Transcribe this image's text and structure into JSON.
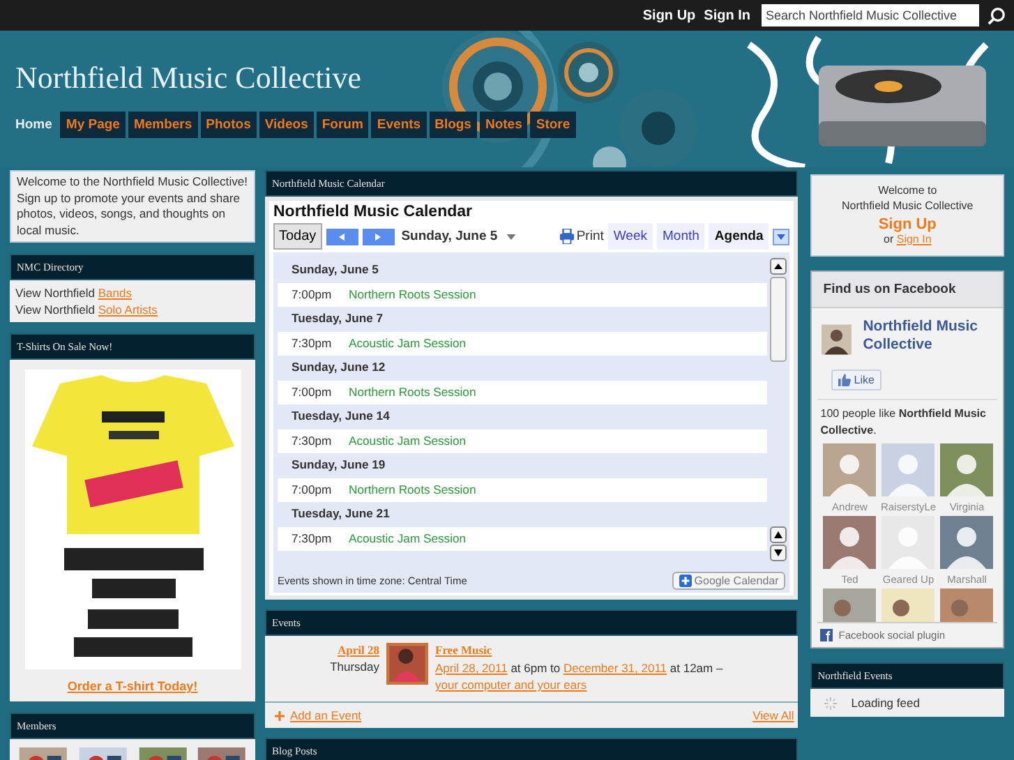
{
  "top_bar": {
    "links": [
      "Sign Up",
      "Sign In"
    ],
    "search": {
      "placeholder": "Search Northfield Music Collective"
    }
  },
  "header": {
    "title": "Northfield Music Collective",
    "nav": [
      {
        "label": "Home",
        "selected": true
      },
      {
        "label": "My Page",
        "selected": false
      },
      {
        "label": "Members",
        "selected": false
      },
      {
        "label": "Photos",
        "selected": false
      },
      {
        "label": "Videos",
        "selected": false
      },
      {
        "label": "Forum",
        "selected": false
      },
      {
        "label": "Events",
        "selected": false
      },
      {
        "label": "Blogs",
        "selected": false
      },
      {
        "label": "Notes",
        "selected": false
      },
      {
        "label": "Store",
        "selected": false
      }
    ]
  },
  "left": {
    "welcome": "Welcome to the Northfield Music Collective! Sign up to promote your events and share photos, videos, songs, and thoughts on local music.",
    "directory": {
      "title": "NMC Directory",
      "rows": [
        {
          "text": "View Northfield",
          "link": "Bands"
        },
        {
          "text": "View Northfield",
          "link": "Solo Artists"
        }
      ]
    },
    "tshirts": {
      "title": "T-Shirts On Sale Now!",
      "link": "Order a T-shirt Today!"
    },
    "members": {
      "title": "Members"
    }
  },
  "calendar": {
    "panel_title": "Northfield Music Calendar",
    "title": "Northfield Music Calendar",
    "today": "Today",
    "date": "Sunday, June 5",
    "print": "Print",
    "views": [
      {
        "label": "Week",
        "selected": false
      },
      {
        "label": "Month",
        "selected": false
      },
      {
        "label": "Agenda",
        "selected": true
      }
    ],
    "days": [
      {
        "day": "Sunday, June 5",
        "events": [
          {
            "time": "7:00pm",
            "title": "Northern Roots Session"
          }
        ]
      },
      {
        "day": "Tuesday, June 7",
        "events": [
          {
            "time": "7:30pm",
            "title": "Acoustic Jam Session"
          }
        ]
      },
      {
        "day": "Sunday, June 12",
        "events": [
          {
            "time": "7:00pm",
            "title": "Northern Roots Session"
          }
        ]
      },
      {
        "day": "Tuesday, June 14",
        "events": [
          {
            "time": "7:30pm",
            "title": "Acoustic Jam Session"
          }
        ]
      },
      {
        "day": "Sunday, June 19",
        "events": [
          {
            "time": "7:00pm",
            "title": "Northern Roots Session"
          }
        ]
      },
      {
        "day": "Tuesday, June 21",
        "events": [
          {
            "time": "7:30pm",
            "title": "Acoustic Jam Session"
          }
        ]
      }
    ],
    "timezone": "Events shown in time zone: Central Time",
    "badge": "Google Calendar"
  },
  "events": {
    "title": "Events",
    "items": [
      {
        "date": "April 28",
        "weekday": "Thursday",
        "name": "Free Music",
        "details": [
          {
            "text": "April 28, 2011",
            "link": true
          },
          {
            "text": " at 6pm to ",
            "link": false
          },
          {
            "text": "December 31, 2011",
            "link": true
          },
          {
            "text": " at 12am – ",
            "link": false
          },
          {
            "text": "your computer and your ears",
            "link": true
          }
        ]
      }
    ],
    "add": "Add an Event",
    "view_all": "View All"
  },
  "blog": {
    "title": "Blog Posts"
  },
  "right": {
    "welcome": [
      "Welcome to",
      "Northfield Music Collective"
    ],
    "signup": "Sign Up",
    "or": "or",
    "signin": "Sign In",
    "facebook": {
      "title": "Find us on Facebook",
      "page": "Northfield Music Collective",
      "like": "Like",
      "summary": "100 people like **Northfield Music Collective**.",
      "people": [
        {
          "name": "Andrew"
        },
        {
          "name": "RaiserstyLe"
        },
        {
          "name": "Virginia"
        },
        {
          "name": "Ted"
        },
        {
          "name": "Geared Up"
        },
        {
          "name": "Marshall"
        }
      ],
      "plugin": "Facebook social plugin"
    },
    "feed": {
      "title": "Northfield Events",
      "status": "Loading feed"
    }
  }
}
